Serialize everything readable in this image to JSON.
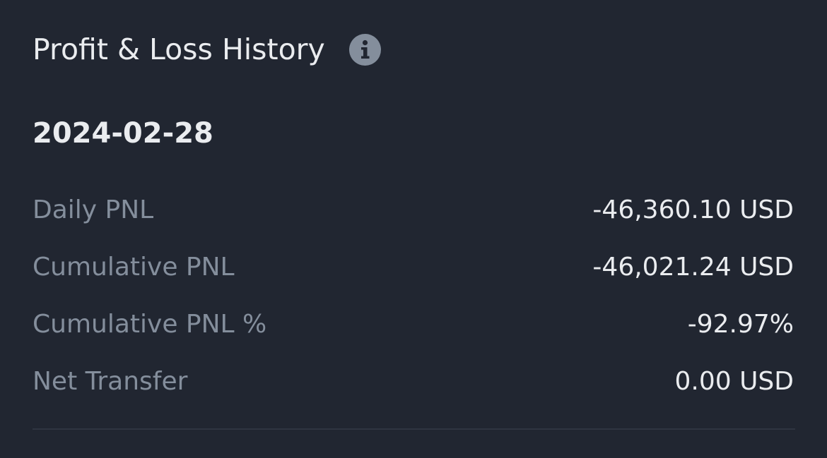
{
  "header": {
    "title": "Profit & Loss History",
    "info_icon": "info-circle-icon"
  },
  "date": "2024-02-28",
  "rows": [
    {
      "label": "Daily PNL",
      "value": "-46,360.10 USD"
    },
    {
      "label": "Cumulative PNL",
      "value": "-46,021.24 USD"
    },
    {
      "label": "Cumulative PNL %",
      "value": "-92.97%"
    },
    {
      "label": "Net Transfer",
      "value": "0.00 USD"
    }
  ],
  "colors": {
    "background": "#212631",
    "primary_text": "#eaecef",
    "secondary_text": "#848e9c",
    "divider": "#2f3541"
  }
}
